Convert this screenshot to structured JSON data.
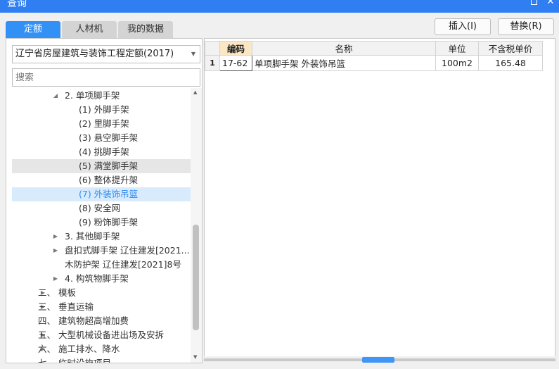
{
  "window": {
    "title": "查询"
  },
  "tabs": [
    "定额",
    "人材机",
    "我的数据"
  ],
  "left": {
    "library_select": "辽宁省房屋建筑与装饰工程定额(2017)",
    "search_placeholder": "搜索",
    "tree": [
      {
        "label": "2. 单项脚手架",
        "arrow": "expanded",
        "level": 2
      },
      {
        "label": "(1) 外脚手架",
        "arrow": "none",
        "level": 3
      },
      {
        "label": "(2) 里脚手架",
        "arrow": "none",
        "level": 3
      },
      {
        "label": "(3) 悬空脚手架",
        "arrow": "none",
        "level": 3
      },
      {
        "label": "(4) 挑脚手架",
        "arrow": "none",
        "level": 3
      },
      {
        "label": "(5) 满堂脚手架",
        "arrow": "none",
        "level": 3,
        "state": "hover"
      },
      {
        "label": "(6) 整体提升架",
        "arrow": "none",
        "level": 3
      },
      {
        "label": "(7) 外装饰吊篮",
        "arrow": "none",
        "level": 3,
        "state": "selected"
      },
      {
        "label": "(8) 安全网",
        "arrow": "none",
        "level": 3
      },
      {
        "label": "(9) 粉饰脚手架",
        "arrow": "none",
        "level": 3
      },
      {
        "label": "3. 其他脚手架",
        "arrow": "collapsed",
        "level": 2
      },
      {
        "label": "盘扣式脚手架 辽住建发[2021...",
        "arrow": "collapsed",
        "level": 2
      },
      {
        "label": "木防护架 辽住建发[2021]8号",
        "arrow": "none",
        "level": 2
      },
      {
        "label": "4. 构筑物脚手架",
        "arrow": "collapsed",
        "level": 2
      },
      {
        "label": "二、 模板",
        "arrow": "collapsed",
        "level": 1
      },
      {
        "label": "三、 垂直运输",
        "arrow": "collapsed",
        "level": 1
      },
      {
        "label": "四、 建筑物超高增加费",
        "arrow": "none",
        "level": 1
      },
      {
        "label": "五、 大型机械设备进出场及安拆",
        "arrow": "collapsed",
        "level": 1
      },
      {
        "label": "六、 施工排水、降水",
        "arrow": "collapsed",
        "level": 1
      },
      {
        "label": "七、 临时设施项目",
        "arrow": "none",
        "level": 1
      }
    ]
  },
  "actions": {
    "insert": "插入(I)",
    "replace": "替换(R)"
  },
  "grid": {
    "columns": [
      "编码",
      "名称",
      "单位",
      "不含税单价"
    ],
    "rows": [
      {
        "index": "1",
        "code": "17-62",
        "name": "单项脚手架 外装饰吊篮",
        "unit": "100m2",
        "price": "165.48"
      }
    ]
  },
  "colors": {
    "accent": "#3390f5",
    "titlebar": "#2f7ff3",
    "selected_bg": "#d7ebfd",
    "active_header": "#fbe7c4"
  }
}
